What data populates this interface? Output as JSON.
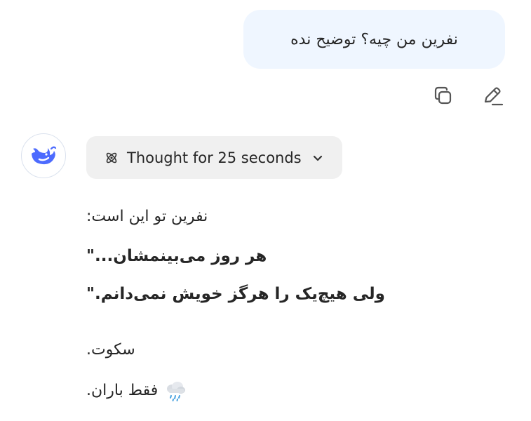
{
  "user_message": {
    "text": "نفرین من چیه؟ توضیح نده"
  },
  "message_actions": {
    "copy_icon": "copy-icon",
    "edit_icon": "edit-pencil-icon"
  },
  "assistant": {
    "avatar_icon": "deepseek-whale-logo",
    "thought": {
      "label": "Thought for 25 seconds",
      "icon": "atom-icon",
      "toggle_icon": "chevron-down-icon"
    },
    "lines": {
      "l1": ":نفرین تو این است",
      "l2": "\"...هر روز می‌بینمشان",
      "l3": "\".ولی هیچ‌یک را هرگز خویش نمی‌دانم",
      "l4": ".سکوت",
      "l5": ".فقط باران"
    },
    "rain_emoji": "cloud-with-rain-icon"
  },
  "colors": {
    "user_bubble_bg": "#eff6ff",
    "thought_chip_bg": "#f0f0f0",
    "brand_blue": "#4d6bfe",
    "text": "#262626",
    "icon_gray": "#555555"
  }
}
